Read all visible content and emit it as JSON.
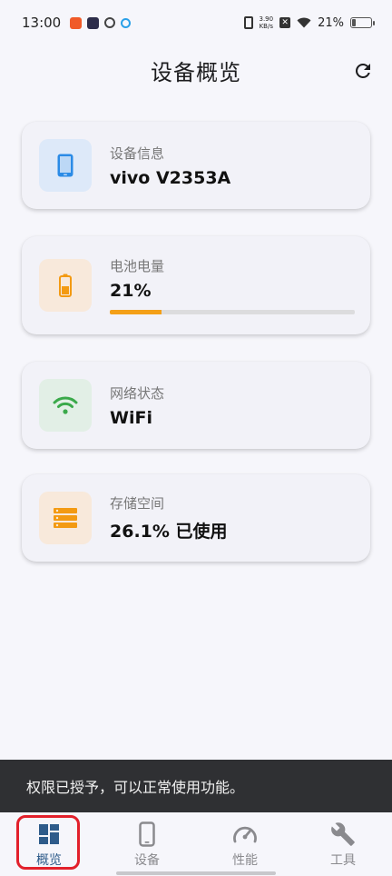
{
  "status_bar": {
    "time": "13:00",
    "net_speed_value": "3.90",
    "net_speed_unit": "KB/s",
    "battery_percent": "21%",
    "battery_level": 0.21
  },
  "header": {
    "title": "设备概览",
    "refresh_icon": "refresh-icon"
  },
  "cards": [
    {
      "label": "设备信息",
      "value": "vivo V2353A",
      "icon": "phone-icon",
      "icon_bg": "#dde9f9",
      "icon_color": "#2b8be6"
    },
    {
      "label": "电池电量",
      "value": "21%",
      "icon": "battery-icon",
      "icon_bg": "#f8e9db",
      "icon_color": "#f39a12",
      "progress": 0.21
    },
    {
      "label": "网络状态",
      "value": "WiFi",
      "icon": "wifi-icon",
      "icon_bg": "#e2efe6",
      "icon_color": "#3aa94a"
    },
    {
      "label": "存储空间",
      "value": "26.1% 已使用",
      "icon": "storage-icon",
      "icon_bg": "#f8e9db",
      "icon_color": "#f39a12"
    }
  ],
  "snackbar": {
    "message": "权限已授予，可以正常使用功能。"
  },
  "bottom_nav": [
    {
      "label": "概览",
      "icon": "dashboard-icon",
      "active": true
    },
    {
      "label": "设备",
      "icon": "phone-icon",
      "active": false
    },
    {
      "label": "性能",
      "icon": "speedometer-icon",
      "active": false
    },
    {
      "label": "工具",
      "icon": "wrench-icon",
      "active": false
    }
  ],
  "colors": {
    "accent": "#2e5b8a",
    "progress": "#f4a018",
    "highlight_frame": "#e2202b"
  }
}
